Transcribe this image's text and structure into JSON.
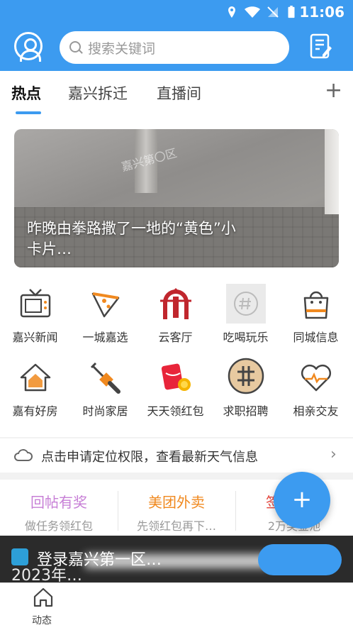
{
  "status": {
    "time": "11:06"
  },
  "search": {
    "placeholder": "搜索关键词"
  },
  "tabs": [
    {
      "label": "热点"
    },
    {
      "label": "嘉兴拆迁"
    },
    {
      "label": "直播间"
    }
  ],
  "tab_add": "+",
  "banner": {
    "title": "昨晚由拳路撒了一地的“黄色”小卡片…",
    "watermark": "嘉兴第〇区"
  },
  "grid": [
    {
      "label": "嘉兴新闻",
      "icon": "tv-icon"
    },
    {
      "label": "一城嘉选",
      "icon": "pizza-icon"
    },
    {
      "label": "云客厅",
      "icon": "yunketing-logo-icon"
    },
    {
      "label": "吃喝玩乐",
      "icon": "hashtag-chat-icon"
    },
    {
      "label": "同城信息",
      "icon": "shopping-bag-icon"
    },
    {
      "label": "嘉有好房",
      "icon": "house-icon"
    },
    {
      "label": "时尚家居",
      "icon": "paint-brush-icon"
    },
    {
      "label": "天天领红包",
      "icon": "red-envelope-icon"
    },
    {
      "label": "求职招聘",
      "icon": "job-badge-icon"
    },
    {
      "label": "相亲交友",
      "icon": "heartbeat-icon"
    }
  ],
  "weather": {
    "text": "点击申请定位权限，查看最新天气信息",
    "arrow": "›"
  },
  "promos": [
    {
      "title": "回帖有奖",
      "subtitle": "做任务领红包",
      "color": "#c77fd6"
    },
    {
      "title": "美团外卖",
      "subtitle": "先领红包再下…",
      "color": "#f0891f"
    },
    {
      "title": "签到…包",
      "subtitle": "2万奖金池",
      "color": "#e8453c"
    }
  ],
  "login_strip": {
    "text": "登录嘉兴第一区…",
    "underlay": "2023年…"
  },
  "fab": "+",
  "bottom_nav": [
    {
      "label": "动态",
      "icon": "home-icon"
    }
  ],
  "colors": {
    "primary": "#3c9bf0"
  }
}
